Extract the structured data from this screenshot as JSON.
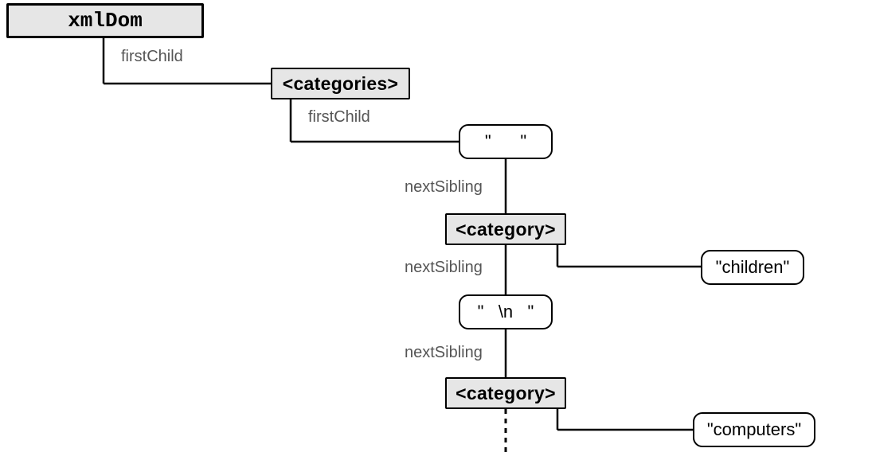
{
  "nodes": {
    "root": {
      "label": "xmlDom"
    },
    "categories": {
      "label": "<categories>"
    },
    "ws1": {
      "label": "\"      \""
    },
    "cat1": {
      "label": "<category>"
    },
    "child1": {
      "label": "\"children\""
    },
    "ws2": {
      "label": "\"   \\n   \""
    },
    "cat2": {
      "label": "<category>"
    },
    "child2": {
      "label": "\"computers\""
    }
  },
  "edges": {
    "e1": "firstChild",
    "e2": "firstChild",
    "e3": "nextSibling",
    "e4": "nextSibling",
    "e5": "nextSibling"
  }
}
